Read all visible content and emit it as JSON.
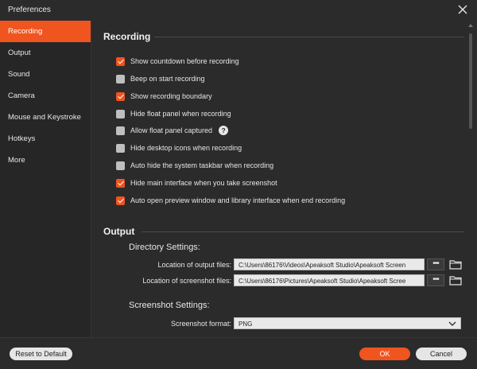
{
  "window": {
    "title": "Preferences"
  },
  "sidebar": {
    "items": [
      {
        "label": "Recording",
        "active": true
      },
      {
        "label": "Output",
        "active": false
      },
      {
        "label": "Sound",
        "active": false
      },
      {
        "label": "Camera",
        "active": false
      },
      {
        "label": "Mouse and Keystroke",
        "active": false
      },
      {
        "label": "Hotkeys",
        "active": false
      },
      {
        "label": "More",
        "active": false
      }
    ]
  },
  "recording": {
    "title": "Recording",
    "options": [
      {
        "label": "Show countdown before recording",
        "checked": true
      },
      {
        "label": "Beep on start recording",
        "checked": false
      },
      {
        "label": "Show recording boundary",
        "checked": true
      },
      {
        "label": "Hide float panel when recording",
        "checked": false
      },
      {
        "label": "Allow float panel captured",
        "checked": false
      },
      {
        "label": "Hide desktop icons when recording",
        "checked": false
      },
      {
        "label": "Auto hide the system taskbar when recording",
        "checked": false
      },
      {
        "label": "Hide main interface when you take screenshot",
        "checked": true
      },
      {
        "label": "Auto open preview window and library interface when end recording",
        "checked": true
      }
    ],
    "help_glyph": "?"
  },
  "output": {
    "title": "Output",
    "directory_title": "Directory Settings:",
    "output_files_label": "Location of output files:",
    "output_files_value": "C:\\Users\\86176\\Videos\\Apeaksoft Studio\\Apeaksoft Screen",
    "screenshot_files_label": "Location of screenshot files:",
    "screenshot_files_value": "C:\\Users\\86176\\Pictures\\Apeaksoft Studio\\Apeaksoft Scree",
    "browse_label": "•••",
    "screenshot_title": "Screenshot Settings:",
    "format_label": "Screenshot format:",
    "format_value": "PNG"
  },
  "footer": {
    "reset_label": "Reset to Default",
    "ok_label": "OK",
    "cancel_label": "Cancel"
  },
  "colors": {
    "accent": "#f0541f",
    "background": "#2b2b2b",
    "sidebar": "#262626"
  },
  "icons": {
    "close": "close-icon",
    "help": "help-icon",
    "folder": "folder-icon",
    "dropdown": "chevron-down-icon"
  }
}
